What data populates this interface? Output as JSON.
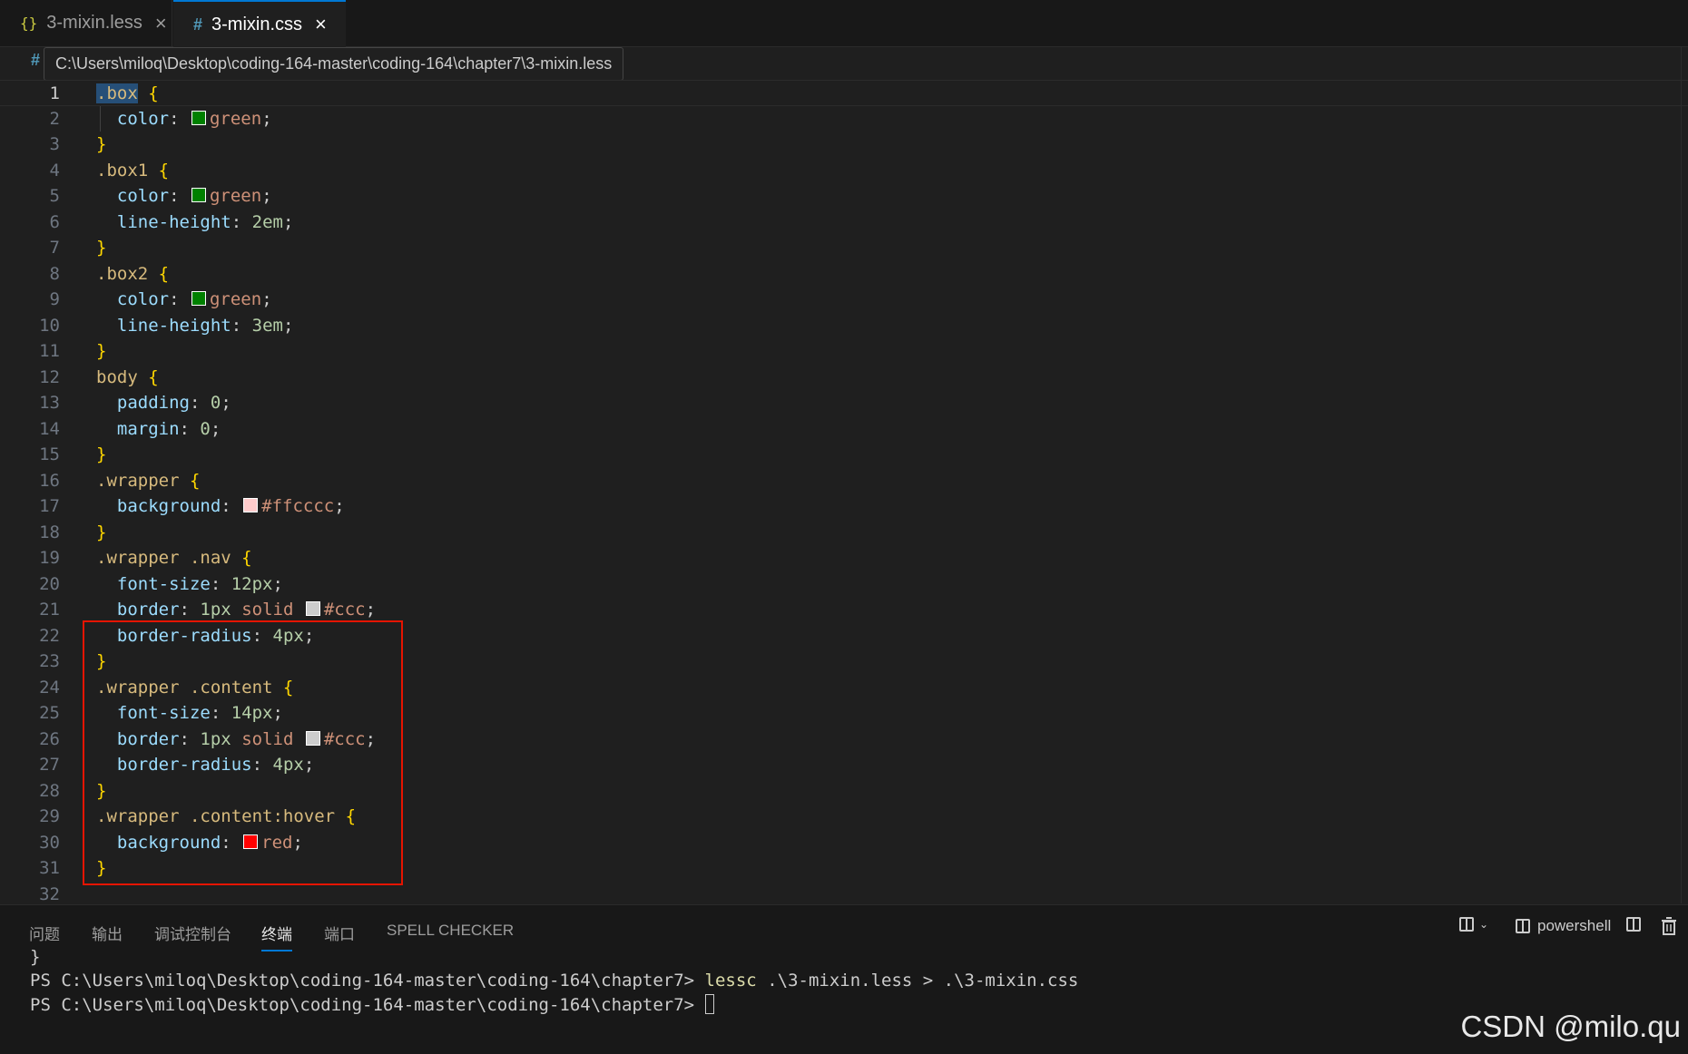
{
  "tabs": [
    {
      "icon": "{}",
      "label": "3-mixin.less",
      "close": "×"
    },
    {
      "icon": "#",
      "label": "3-mixin.css",
      "close": "×"
    }
  ],
  "breadcrumb": {
    "hash": "#",
    "tooltip": "C:\\Users\\miloq\\Desktop\\coding-164-master\\coding-164\\chapter7\\3-mixin.less"
  },
  "code_lines": [
    {
      "n": "1",
      "segs": [
        {
          "t": ".box",
          "c": "sel-hl"
        },
        {
          "t": " "
        },
        {
          "t": "{",
          "c": "brace"
        }
      ]
    },
    {
      "n": "2",
      "segs": [
        {
          "t": "  "
        },
        {
          "t": "color",
          "c": "prop"
        },
        {
          "t": ": ",
          "c": "punc"
        },
        {
          "sw": "#008000"
        },
        {
          "t": "green",
          "c": "val"
        },
        {
          "t": ";",
          "c": "punc"
        }
      ]
    },
    {
      "n": "3",
      "segs": [
        {
          "t": "}",
          "c": "brace"
        }
      ]
    },
    {
      "n": "4",
      "segs": [
        {
          "t": ".box1",
          "c": "sel"
        },
        {
          "t": " "
        },
        {
          "t": "{",
          "c": "brace"
        }
      ]
    },
    {
      "n": "5",
      "segs": [
        {
          "t": "  "
        },
        {
          "t": "color",
          "c": "prop"
        },
        {
          "t": ": ",
          "c": "punc"
        },
        {
          "sw": "#008000"
        },
        {
          "t": "green",
          "c": "val"
        },
        {
          "t": ";",
          "c": "punc"
        }
      ]
    },
    {
      "n": "6",
      "segs": [
        {
          "t": "  "
        },
        {
          "t": "line-height",
          "c": "prop"
        },
        {
          "t": ": ",
          "c": "punc"
        },
        {
          "t": "2em",
          "c": "num"
        },
        {
          "t": ";",
          "c": "punc"
        }
      ]
    },
    {
      "n": "7",
      "segs": [
        {
          "t": "}",
          "c": "brace"
        }
      ]
    },
    {
      "n": "8",
      "segs": [
        {
          "t": ".box2",
          "c": "sel"
        },
        {
          "t": " "
        },
        {
          "t": "{",
          "c": "brace"
        }
      ]
    },
    {
      "n": "9",
      "segs": [
        {
          "t": "  "
        },
        {
          "t": "color",
          "c": "prop"
        },
        {
          "t": ": ",
          "c": "punc"
        },
        {
          "sw": "#008000"
        },
        {
          "t": "green",
          "c": "val"
        },
        {
          "t": ";",
          "c": "punc"
        }
      ]
    },
    {
      "n": "10",
      "segs": [
        {
          "t": "  "
        },
        {
          "t": "line-height",
          "c": "prop"
        },
        {
          "t": ": ",
          "c": "punc"
        },
        {
          "t": "3em",
          "c": "num"
        },
        {
          "t": ";",
          "c": "punc"
        }
      ]
    },
    {
      "n": "11",
      "segs": [
        {
          "t": "}",
          "c": "brace"
        }
      ]
    },
    {
      "n": "12",
      "segs": [
        {
          "t": "body",
          "c": "sel"
        },
        {
          "t": " "
        },
        {
          "t": "{",
          "c": "brace"
        }
      ]
    },
    {
      "n": "13",
      "segs": [
        {
          "t": "  "
        },
        {
          "t": "padding",
          "c": "prop"
        },
        {
          "t": ": ",
          "c": "punc"
        },
        {
          "t": "0",
          "c": "num"
        },
        {
          "t": ";",
          "c": "punc"
        }
      ]
    },
    {
      "n": "14",
      "segs": [
        {
          "t": "  "
        },
        {
          "t": "margin",
          "c": "prop"
        },
        {
          "t": ": ",
          "c": "punc"
        },
        {
          "t": "0",
          "c": "num"
        },
        {
          "t": ";",
          "c": "punc"
        }
      ]
    },
    {
      "n": "15",
      "segs": [
        {
          "t": "}",
          "c": "brace"
        }
      ]
    },
    {
      "n": "16",
      "segs": [
        {
          "t": ".wrapper",
          "c": "sel"
        },
        {
          "t": " "
        },
        {
          "t": "{",
          "c": "brace"
        }
      ]
    },
    {
      "n": "17",
      "segs": [
        {
          "t": "  "
        },
        {
          "t": "background",
          "c": "prop"
        },
        {
          "t": ": ",
          "c": "punc"
        },
        {
          "sw": "#ffcccc"
        },
        {
          "t": "#ffcccc",
          "c": "val"
        },
        {
          "t": ";",
          "c": "punc"
        }
      ]
    },
    {
      "n": "18",
      "segs": [
        {
          "t": "}",
          "c": "brace"
        }
      ]
    },
    {
      "n": "19",
      "segs": [
        {
          "t": ".wrapper .nav",
          "c": "sel"
        },
        {
          "t": " "
        },
        {
          "t": "{",
          "c": "brace"
        }
      ]
    },
    {
      "n": "20",
      "segs": [
        {
          "t": "  "
        },
        {
          "t": "font-size",
          "c": "prop"
        },
        {
          "t": ": ",
          "c": "punc"
        },
        {
          "t": "12px",
          "c": "num"
        },
        {
          "t": ";",
          "c": "punc"
        }
      ]
    },
    {
      "n": "21",
      "segs": [
        {
          "t": "  "
        },
        {
          "t": "border",
          "c": "prop"
        },
        {
          "t": ": ",
          "c": "punc"
        },
        {
          "t": "1px",
          "c": "num"
        },
        {
          "t": " "
        },
        {
          "t": "solid",
          "c": "val"
        },
        {
          "t": " "
        },
        {
          "sw": "#cccccc"
        },
        {
          "t": "#ccc",
          "c": "val"
        },
        {
          "t": ";",
          "c": "punc"
        }
      ]
    },
    {
      "n": "22",
      "segs": [
        {
          "t": "  "
        },
        {
          "t": "border-radius",
          "c": "prop"
        },
        {
          "t": ": ",
          "c": "punc"
        },
        {
          "t": "4px",
          "c": "num"
        },
        {
          "t": ";",
          "c": "punc"
        }
      ]
    },
    {
      "n": "23",
      "segs": [
        {
          "t": "}",
          "c": "brace"
        }
      ]
    },
    {
      "n": "24",
      "segs": [
        {
          "t": ".wrapper .content",
          "c": "sel"
        },
        {
          "t": " "
        },
        {
          "t": "{",
          "c": "brace"
        }
      ]
    },
    {
      "n": "25",
      "segs": [
        {
          "t": "  "
        },
        {
          "t": "font-size",
          "c": "prop"
        },
        {
          "t": ": ",
          "c": "punc"
        },
        {
          "t": "14px",
          "c": "num"
        },
        {
          "t": ";",
          "c": "punc"
        }
      ]
    },
    {
      "n": "26",
      "segs": [
        {
          "t": "  "
        },
        {
          "t": "border",
          "c": "prop"
        },
        {
          "t": ": ",
          "c": "punc"
        },
        {
          "t": "1px",
          "c": "num"
        },
        {
          "t": " "
        },
        {
          "t": "solid",
          "c": "val"
        },
        {
          "t": " "
        },
        {
          "sw": "#cccccc"
        },
        {
          "t": "#ccc",
          "c": "val"
        },
        {
          "t": ";",
          "c": "punc"
        }
      ]
    },
    {
      "n": "27",
      "segs": [
        {
          "t": "  "
        },
        {
          "t": "border-radius",
          "c": "prop"
        },
        {
          "t": ": ",
          "c": "punc"
        },
        {
          "t": "4px",
          "c": "num"
        },
        {
          "t": ";",
          "c": "punc"
        }
      ]
    },
    {
      "n": "28",
      "segs": [
        {
          "t": "}",
          "c": "brace"
        }
      ]
    },
    {
      "n": "29",
      "segs": [
        {
          "t": ".wrapper .content:hover",
          "c": "sel"
        },
        {
          "t": " "
        },
        {
          "t": "{",
          "c": "brace"
        }
      ]
    },
    {
      "n": "30",
      "segs": [
        {
          "t": "  "
        },
        {
          "t": "background",
          "c": "prop"
        },
        {
          "t": ": ",
          "c": "punc"
        },
        {
          "sw": "#ff0000"
        },
        {
          "t": "red",
          "c": "val"
        },
        {
          "t": ";",
          "c": "punc"
        }
      ]
    },
    {
      "n": "31",
      "segs": [
        {
          "t": "}",
          "c": "brace"
        }
      ]
    },
    {
      "n": "32",
      "segs": []
    }
  ],
  "panel": {
    "tabs": [
      "问题",
      "输出",
      "调试控制台",
      "终端",
      "端口",
      "SPELL CHECKER"
    ],
    "active_tab": "终端",
    "shell_label": "powershell"
  },
  "terminal": {
    "line1": "}",
    "prompt": "PS C:\\Users\\miloq\\Desktop\\coding-164-master\\coding-164\\chapter7> ",
    "command_name": "lessc",
    "command_args": " .\\3-mixin.less > .\\3-mixin.css"
  },
  "watermark": "CSDN @milo.qu",
  "colors": {
    "accent": "#0078d4",
    "highlight_box": "#e51400"
  }
}
